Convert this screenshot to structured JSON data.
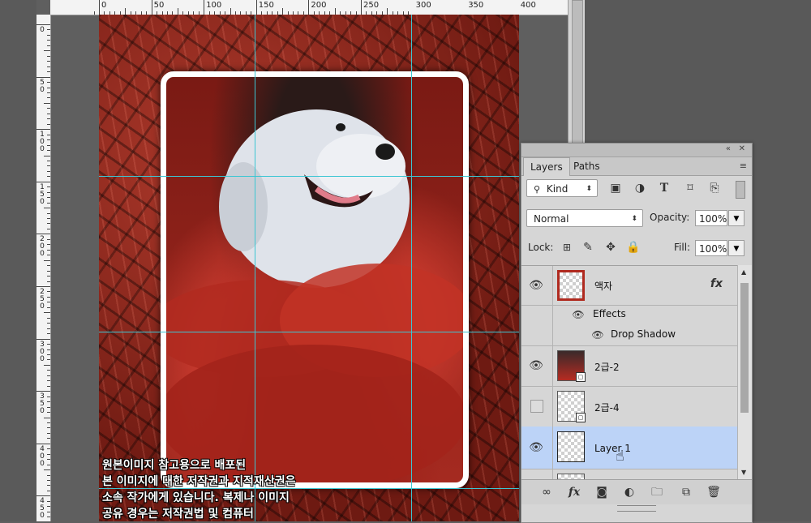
{
  "ruler": {
    "top_labels": [
      "0",
      "50",
      "100",
      "150",
      "200",
      "250",
      "300",
      "350",
      "400"
    ],
    "left_labels": [
      "0",
      "50",
      "100",
      "150",
      "200",
      "250",
      "300",
      "350",
      "400",
      "450"
    ]
  },
  "canvas": {
    "caption_lines": [
      "원본이미지 참고용으로 배포된",
      "본 이미지에 대한 저작권과 지적재산권은",
      "소속 작가에게 있습니다. 복제나 이미지",
      "공유 경우는 저작권법 및 컴퓨터"
    ],
    "guide_color": "#3cc6d3"
  },
  "panel": {
    "collapse_icon": "«",
    "close_icon": "✕",
    "menu_icon": "≡",
    "tabs": [
      {
        "label": "Layers",
        "active": true
      },
      {
        "label": "Paths",
        "active": false
      }
    ],
    "filter": {
      "kind_label": "Kind",
      "kind_icon": "search-icon",
      "filter_icons": [
        "image-filter-icon",
        "adjustment-filter-icon",
        "type-filter-icon",
        "shape-filter-icon",
        "smart-object-filter-icon",
        "filter-toggle-icon"
      ]
    },
    "blend_mode": "Normal",
    "opacity_label": "Opacity:",
    "opacity_value": "100%",
    "lock_label": "Lock:",
    "lock_icons": [
      "lock-transparent-icon",
      "lock-image-icon",
      "lock-position-icon",
      "lock-all-icon"
    ],
    "fill_label": "Fill:",
    "fill_value": "100%",
    "layers": [
      {
        "name": "액자",
        "visible": true,
        "fx": "fx",
        "effects_label": "Effects",
        "effect": "Drop Shadow"
      },
      {
        "name": "2급-2",
        "visible": true,
        "smart": true
      },
      {
        "name": "2급-4",
        "visible": false,
        "smart": true
      },
      {
        "name": "Layer 1",
        "visible": true,
        "selected": true,
        "selected_color": "#bcd3f7"
      }
    ],
    "bottom_icons": [
      "link-layers-icon",
      "fx-icon",
      "mask-icon",
      "adjustment-layer-icon",
      "group-folder-icon",
      "new-layer-icon",
      "trash-icon"
    ]
  }
}
